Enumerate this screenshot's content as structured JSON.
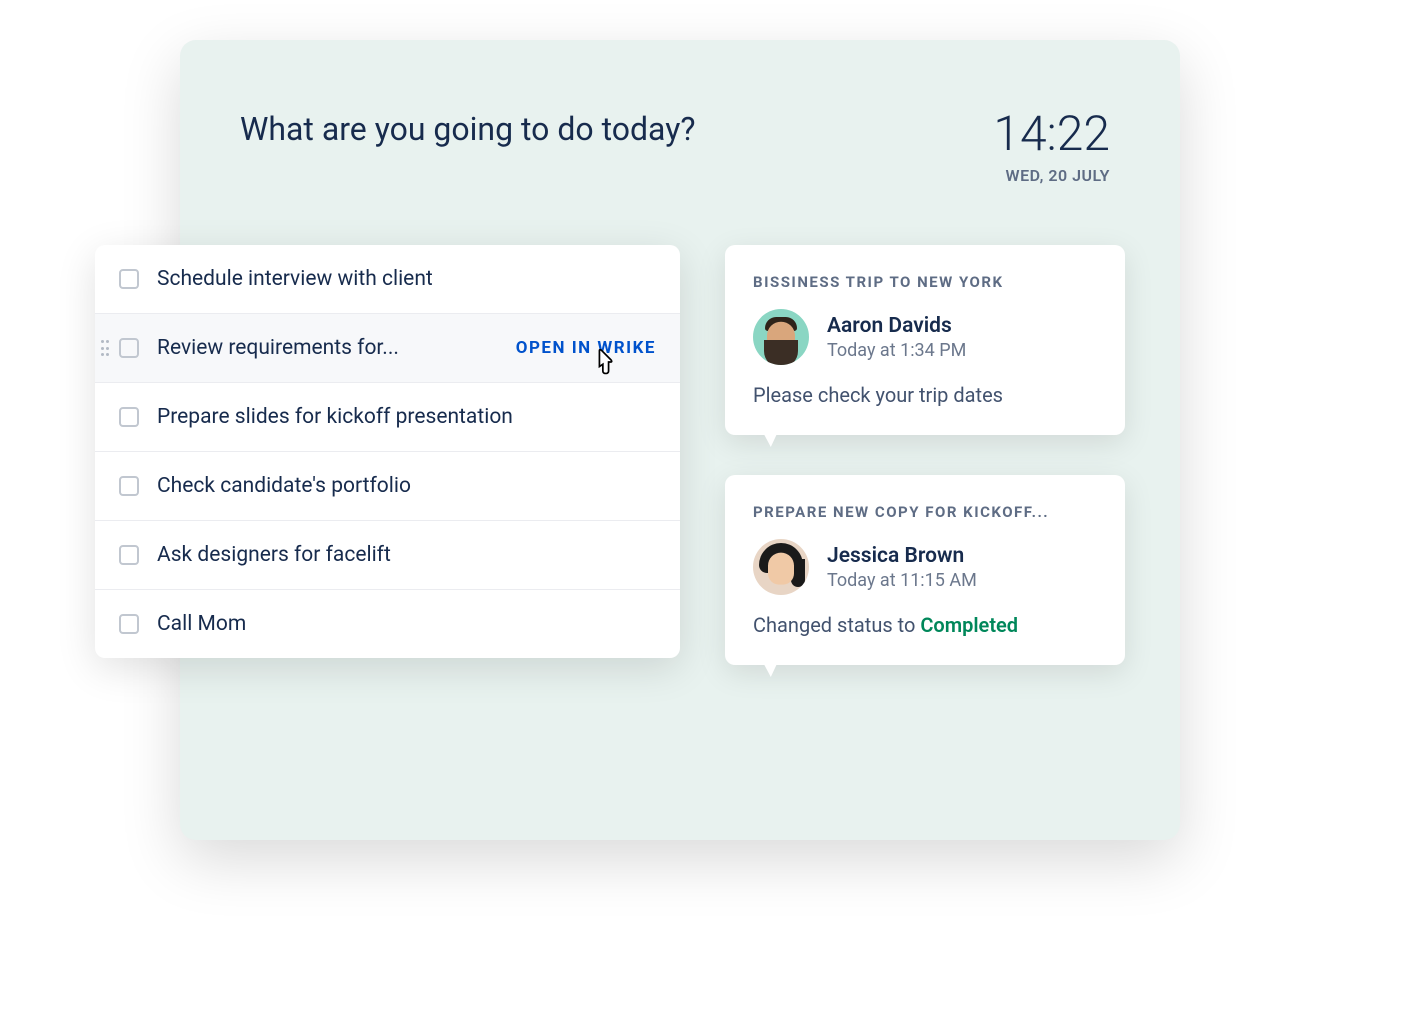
{
  "header": {
    "title": "What are you going to do today?",
    "time": "14:22",
    "date": "WED, 20 JULY"
  },
  "tasks": [
    {
      "label": "Schedule interview with client"
    },
    {
      "label": "Review requirements for...",
      "hovered": true,
      "link": "OPEN IN WRIKE"
    },
    {
      "label": "Prepare slides for kickoff presentation"
    },
    {
      "label": "Check candidate's portfolio"
    },
    {
      "label": "Ask designers for facelift"
    },
    {
      "label": "Call Mom"
    }
  ],
  "activities": [
    {
      "title": "BISSINESS TRIP TO NEW YORK",
      "user_name": "Aaron Davids",
      "user_time": "Today at 1:34 PM",
      "message": "Please check your trip dates"
    },
    {
      "title": "PREPARE NEW COPY FOR KICKOFF...",
      "user_name": "Jessica Brown",
      "user_time": "Today at 11:15 AM",
      "message_prefix": "Changed status to ",
      "status": "Completed"
    }
  ]
}
